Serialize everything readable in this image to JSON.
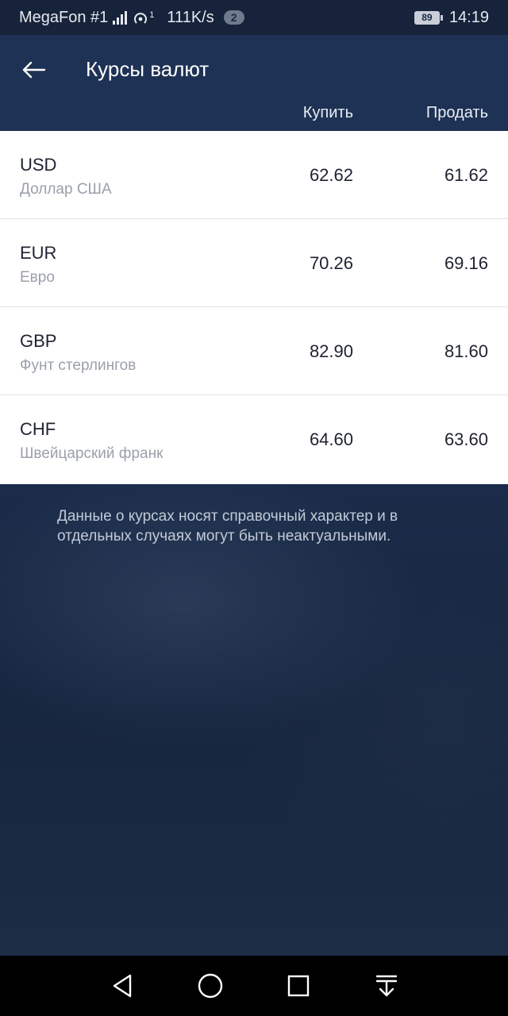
{
  "status_bar": {
    "carrier": "MegaFon #1",
    "network_speed": "111K/s",
    "notification_count": "2",
    "battery_level": "89",
    "time": "14:19",
    "hotspot_superscript": "1"
  },
  "header": {
    "title": "Курсы валют",
    "col_buy": "Купить",
    "col_sell": "Продать"
  },
  "rates": [
    {
      "code": "USD",
      "name": "Доллар США",
      "buy": "62.62",
      "sell": "61.62"
    },
    {
      "code": "EUR",
      "name": "Евро",
      "buy": "70.26",
      "sell": "69.16"
    },
    {
      "code": "GBP",
      "name": "Фунт стерлингов",
      "buy": "82.90",
      "sell": "81.60"
    },
    {
      "code": "CHF",
      "name": "Швейцарский франк",
      "buy": "64.60",
      "sell": "63.60"
    }
  ],
  "disclaimer": "Данные о курсах носят справочный характер и в отдельных случаях могут быть неактуальными.",
  "colors": {
    "header_bg": "#1e3255",
    "status_bg": "#16233a",
    "list_bg": "#ffffff",
    "primary_text": "#1f2330",
    "secondary_text": "#9aa0aa"
  }
}
